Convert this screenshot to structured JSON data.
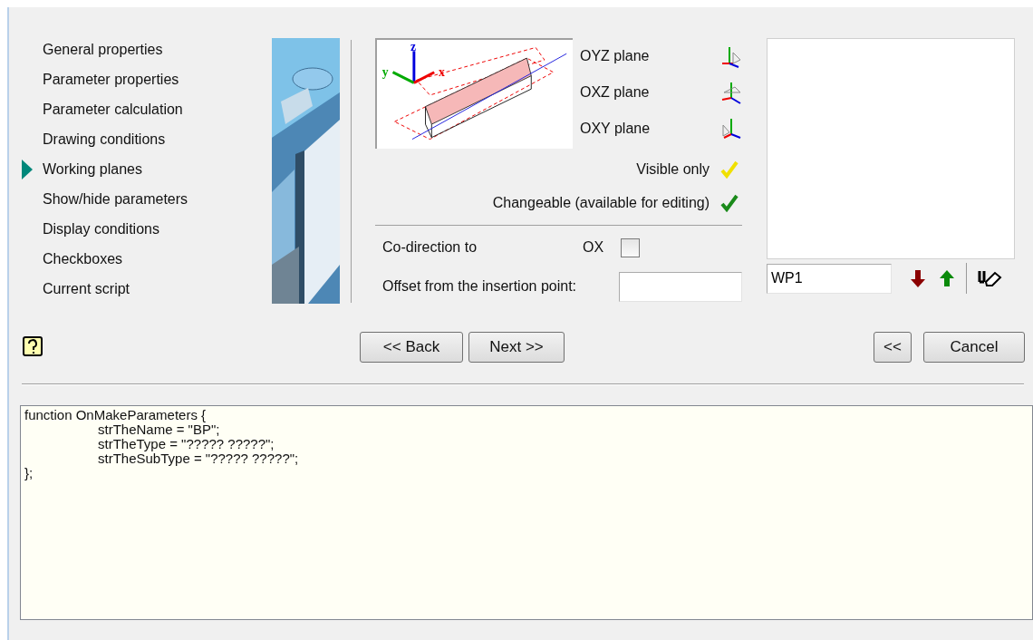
{
  "nav": {
    "items": [
      {
        "label": "General properties",
        "selected": false
      },
      {
        "label": "Parameter properties",
        "selected": false
      },
      {
        "label": "Parameter calculation",
        "selected": false
      },
      {
        "label": "Drawing conditions",
        "selected": false
      },
      {
        "label": "Working planes",
        "selected": true
      },
      {
        "label": "Show/hide parameters",
        "selected": false
      },
      {
        "label": "Display conditions",
        "selected": false
      },
      {
        "label": "Checkboxes",
        "selected": false
      },
      {
        "label": "Current script",
        "selected": false
      }
    ]
  },
  "diagram": {
    "axis_labels": [
      "z",
      "y",
      "x"
    ]
  },
  "planes": [
    {
      "label": "OYZ plane",
      "kind": "yz"
    },
    {
      "label": "OXZ plane",
      "kind": "xz"
    },
    {
      "label": "OXY plane",
      "kind": "xy"
    }
  ],
  "modes": [
    {
      "label": "Visible only",
      "color": "#f0e000"
    },
    {
      "label": "Changeable (available for editing)",
      "color": "#1a8a1a"
    }
  ],
  "codirection": {
    "label": "Co-direction to",
    "axis": "OX",
    "checked": false
  },
  "offset": {
    "label": "Offset from the insertion point:"
  },
  "plane_name": {
    "value": "WP1"
  },
  "buttons": {
    "back": "<< Back",
    "next": "Next >>",
    "collapse": "<<",
    "cancel": "Cancel"
  },
  "code": [
    {
      "text": "function OnMakeParameters {",
      "kind": "plain"
    },
    {
      "text": "strTheName = \"BP\";",
      "kind": "indented"
    },
    {
      "text": "strTheType = \"????? ?????\";",
      "kind": "indented"
    },
    {
      "text": "strTheSubType = \"????? ?????\";",
      "kind": "indented"
    },
    {
      "text": "};",
      "kind": "plain"
    }
  ]
}
